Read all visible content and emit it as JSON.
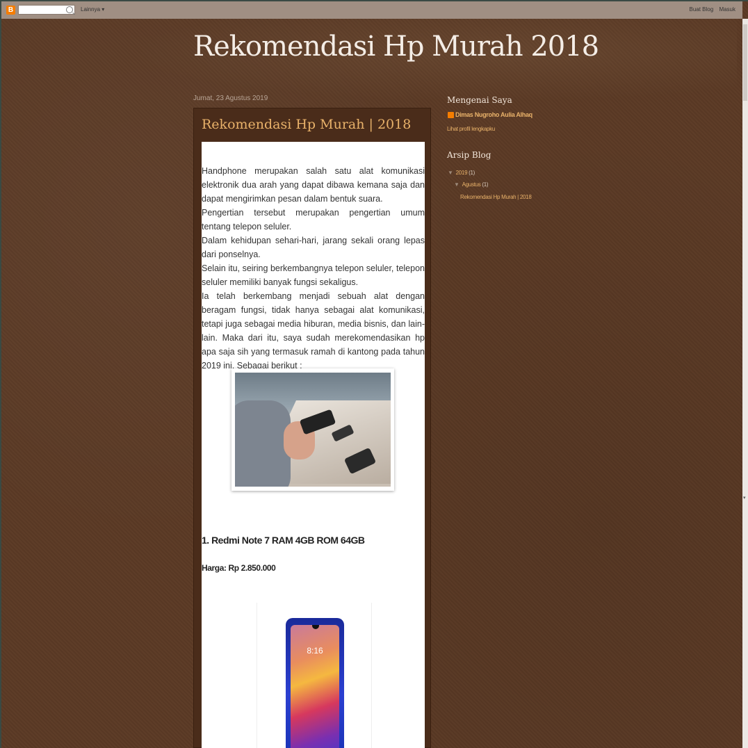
{
  "navbar": {
    "more_label": "Lainnya ▾",
    "create_blog": "Buat Blog",
    "sign_in": "Masuk"
  },
  "blog": {
    "title": "Rekomendasi Hp Murah 2018"
  },
  "post": {
    "date": "Jumat, 23 Agustus 2019",
    "title": "Rekomendasi Hp Murah | 2018",
    "paragraphs": [
      "Handphone merupakan salah satu alat komunikasi elektronik dua arah yang dapat dibawa kemana saja dan dapat mengirimkan pesan dalam bentuk suara.",
      " Pengertian tersebut merupakan pengertian umum tentang telepon seluler.",
      " Dalam kehidupan sehari-hari, jarang sekali orang lepas dari ponselnya.",
      " Selain itu, seiring berkembangnya telepon seluler, telepon seluler memiliki banyak fungsi sekaligus.",
      " Ia telah berkembang menjadi sebuah alat dengan beragam fungsi, tidak hanya sebagai alat komunikasi, tetapi juga sebagai media hiburan, media bisnis, dan lain-lain. Maka dari itu, saya sudah merekomendasikan hp apa saja sih yang termasuk ramah di kantong pada tahun 2019 ini. Sebagai berikut :"
    ],
    "item1_heading": "1. Redmi Note 7 RAM 4GB ROM 64GB",
    "item1_price": "Harga: Rp 2.850.000",
    "phone_clock": "8:16"
  },
  "sidebar": {
    "about_heading": "Mengenai Saya",
    "profile_name": "Dimas Nugroho Aulia Alhaq",
    "profile_link": "Lihat profil lengkapku",
    "archive_heading": "Arsip Blog",
    "archive_year": "2019",
    "archive_year_count": "(1)",
    "archive_month": "Agustus",
    "archive_month_count": "(1)",
    "archive_post": "Rekomendasi Hp Murah | 2018"
  },
  "colors": {
    "background": "#5b3a25",
    "link": "#e9b26a",
    "blogger_orange": "#f57d00"
  }
}
